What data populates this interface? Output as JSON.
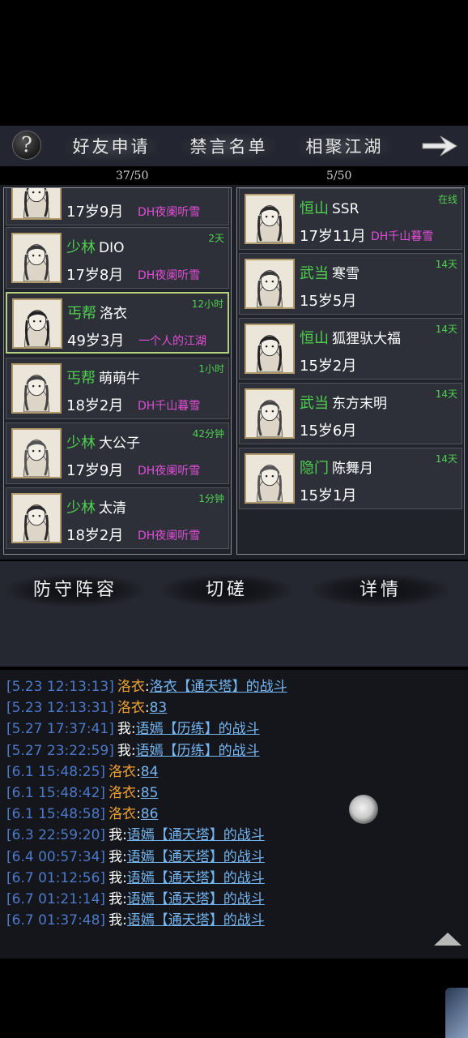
{
  "nav": {
    "help_label": "?",
    "tabs": [
      "好友申请",
      "禁言名单",
      "相聚江湖"
    ]
  },
  "counts": {
    "left": "37/50",
    "right": "5/50"
  },
  "left_list": [
    {
      "sect": "",
      "name": "",
      "age": "17岁9月",
      "server": "DH夜阑听雪",
      "status": ""
    },
    {
      "sect": "少林",
      "name": "DIO",
      "age": "17岁8月",
      "server": "DH夜阑听雪",
      "status": "2天"
    },
    {
      "sect": "丐帮",
      "name": "洛衣",
      "age": "49岁3月",
      "server": "一个人的江湖",
      "status": "12小时"
    },
    {
      "sect": "丐帮",
      "name": "萌萌牛",
      "age": "18岁2月",
      "server": "DH千山暮雪",
      "status": "1小时"
    },
    {
      "sect": "少林",
      "name": "大公子",
      "age": "17岁9月",
      "server": "DH夜阑听雪",
      "status": "42分钟"
    },
    {
      "sect": "少林",
      "name": "太清",
      "age": "18岁2月",
      "server": "DH夜阑听雪",
      "status": "1分钟"
    }
  ],
  "right_list": [
    {
      "sect": "恒山",
      "name": "SSR",
      "age": "17岁11月",
      "server": "DH千山暮雪",
      "status": "在线"
    },
    {
      "sect": "武当",
      "name": "寒雪",
      "age": "15岁5月",
      "server": "",
      "status": "14天"
    },
    {
      "sect": "恒山",
      "name": "狐狸驮大福",
      "age": "15岁2月",
      "server": "",
      "status": "14天"
    },
    {
      "sect": "武当",
      "name": "东方末明",
      "age": "15岁6月",
      "server": "",
      "status": "14天"
    },
    {
      "sect": "隐门",
      "name": "陈舞月",
      "age": "15岁1月",
      "server": "",
      "status": "14天"
    }
  ],
  "actions": [
    "防守阵容",
    "切磋",
    "详情"
  ],
  "log": [
    {
      "time": "[5.23 12:13:13]",
      "who": "洛衣",
      "sep": ":",
      "text": "洛衣【通天塔】的战斗"
    },
    {
      "time": "[5.23 12:13:31]",
      "who": "洛衣",
      "sep": ":",
      "text": "83"
    },
    {
      "time": "[5.27 17:37:41]",
      "who": "我",
      "sep": ":",
      "text": "语嫣【历练】的战斗"
    },
    {
      "time": "[5.27 23:22:59]",
      "who": "我",
      "sep": ":",
      "text": "语嫣【历练】的战斗"
    },
    {
      "time": "[6.1 15:48:25]",
      "who": "洛衣",
      "sep": ":",
      "text": "84"
    },
    {
      "time": "[6.1 15:48:42]",
      "who": "洛衣",
      "sep": ":",
      "text": "85"
    },
    {
      "time": "[6.1 15:48:58]",
      "who": "洛衣",
      "sep": ":",
      "text": "86"
    },
    {
      "time": "[6.3 22:59:20]",
      "who": "我",
      "sep": ":",
      "text": "语嫣【通天塔】的战斗"
    },
    {
      "time": "[6.4 00:57:34]",
      "who": "我",
      "sep": ":",
      "text": "语嫣【通天塔】的战斗"
    },
    {
      "time": "[6.7 01:12:56]",
      "who": "我",
      "sep": ":",
      "text": "语嫣【通天塔】的战斗"
    },
    {
      "time": "[6.7 01:21:14]",
      "who": "我",
      "sep": ":",
      "text": "语嫣【通天塔】的战斗"
    },
    {
      "time": "[6.7 01:37:48]",
      "who": "我",
      "sep": ":",
      "text": "语嫣【通天塔】的战斗"
    }
  ],
  "colors": {
    "sect_green": "#4ed14e",
    "server_magenta": "#e04ed6",
    "log_orange": "#f0a030",
    "log_blue": "#75b5f0",
    "selected_border": "#b6cf7d"
  }
}
